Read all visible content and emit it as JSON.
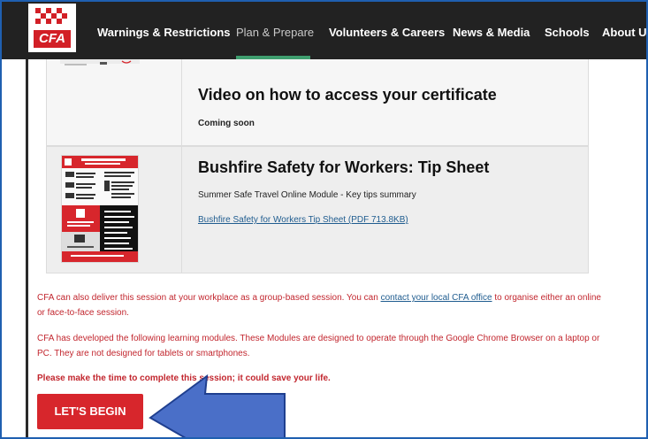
{
  "nav": {
    "logo_text": "CFA",
    "items": [
      {
        "label": "Warnings & Restrictions"
      },
      {
        "label": "Plan & Prepare"
      },
      {
        "label": "Volunteers & Careers"
      },
      {
        "label": "News & Media"
      },
      {
        "label": "Schools"
      },
      {
        "label": "About Us"
      }
    ],
    "active": "Plan & Prepare"
  },
  "resources": [
    {
      "title": "Video on how to access your certificate",
      "subtitle": "Coming soon"
    },
    {
      "title": "Bushfire Safety for Workers: Tip Sheet",
      "subtitle": "Summer Safe Travel Online Module - Key tips summary",
      "link": "Bushfire Safety for Workers Tip Sheet (PDF 713.8KB)"
    }
  ],
  "body": {
    "para1_before": "CFA can also deliver this session at your workplace as a group-based session. You can ",
    "para1_link": "contact your local CFA office",
    "para1_after": " to organise either an online or face-to-face session.",
    "para2": "CFA has developed the following learning modules. These Modules are designed to operate through the Google Chrome Browser on a laptop or PC. They are not designed for tablets or smartphones.",
    "para3": "Please make the time to complete this session; it could save your life.",
    "begin_label": "LET'S BEGIN"
  },
  "colors": {
    "brand_red": "#d7262c",
    "body_text_red": "#c2262e",
    "nav_bg": "#222222",
    "nav_active_underline": "#3f9e6f",
    "link_blue": "#1f5c8f",
    "arrow_fill": "#4a6fc8",
    "arrow_stroke": "#1f3f8f"
  }
}
